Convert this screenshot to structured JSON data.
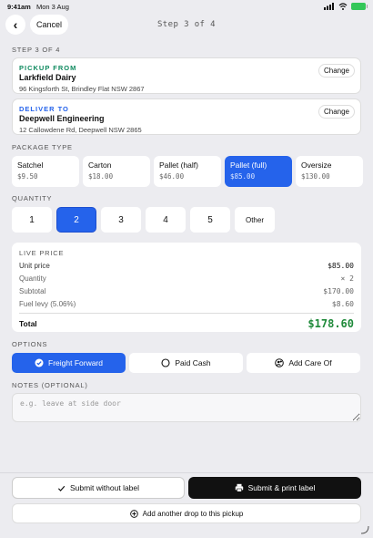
{
  "status_bar": {
    "time": "9:41am",
    "date": "Mon 3 Aug"
  },
  "nav": {
    "back": "‹",
    "cancel_label": "Cancel",
    "step_title": "Step 3 of 4"
  },
  "section": {
    "step_label": "STEP 3 OF 4",
    "package_type": "PACKAGE TYPE",
    "quantity": "QUANTITY",
    "options": "OPTIONS",
    "notes": "NOTES (OPTIONAL)"
  },
  "pickup": {
    "kind": "PICKUP FROM",
    "name": "Larkfield Dairy",
    "street": "96 Kingsforth St, Brindley Flat NSW 2867",
    "change_label": "Change",
    "color": "#0f8a5f"
  },
  "deliver": {
    "kind": "DELIVER TO",
    "name": "Deepwell Engineering",
    "street": "12 Callowdene Rd, Deepwell NSW 2865",
    "change_label": "Change",
    "color": "#2563eb"
  },
  "packages": [
    {
      "name": "Satchel",
      "price": "$9.50"
    },
    {
      "name": "Carton",
      "price": "$18.00"
    },
    {
      "name": "Pallet (half)",
      "price": "$46.00"
    },
    {
      "name": "Pallet (full)",
      "price": "$85.00",
      "selected": true
    },
    {
      "name": "Oversize",
      "price": "$130.00"
    }
  ],
  "quantity": {
    "options": [
      "1",
      "2",
      "3",
      "4",
      "5"
    ],
    "selected": "2",
    "other_label": "Other"
  },
  "live_price": {
    "label": "LIVE PRICE",
    "unit_label": "Unit price",
    "unit_value": "$85.00",
    "qty_label": "Quantity",
    "qty_value": "× 2",
    "subtotal_label": "Subtotal",
    "subtotal_value": "$170.00",
    "fuel_label": "Fuel levy (5.06%)",
    "fuel_value": "$8.60",
    "total_label": "Total",
    "total_value": "$178.60"
  },
  "options": [
    {
      "label": "Freight Forward",
      "icon": "check-circle-icon",
      "selected": true
    },
    {
      "label": "Paid Cash",
      "icon": "circle-icon"
    },
    {
      "label": "Add Care Of",
      "icon": "add-person-icon"
    }
  ],
  "notes": {
    "placeholder": "e.g. leave at side door"
  },
  "actions": {
    "submit_no_label": "Submit without label",
    "submit_print": "Submit & print label",
    "add_drop": "Add another drop to this pickup"
  },
  "colors": {
    "accent": "#2563eb",
    "total": "#1f8a3a",
    "dark": "#111111"
  }
}
